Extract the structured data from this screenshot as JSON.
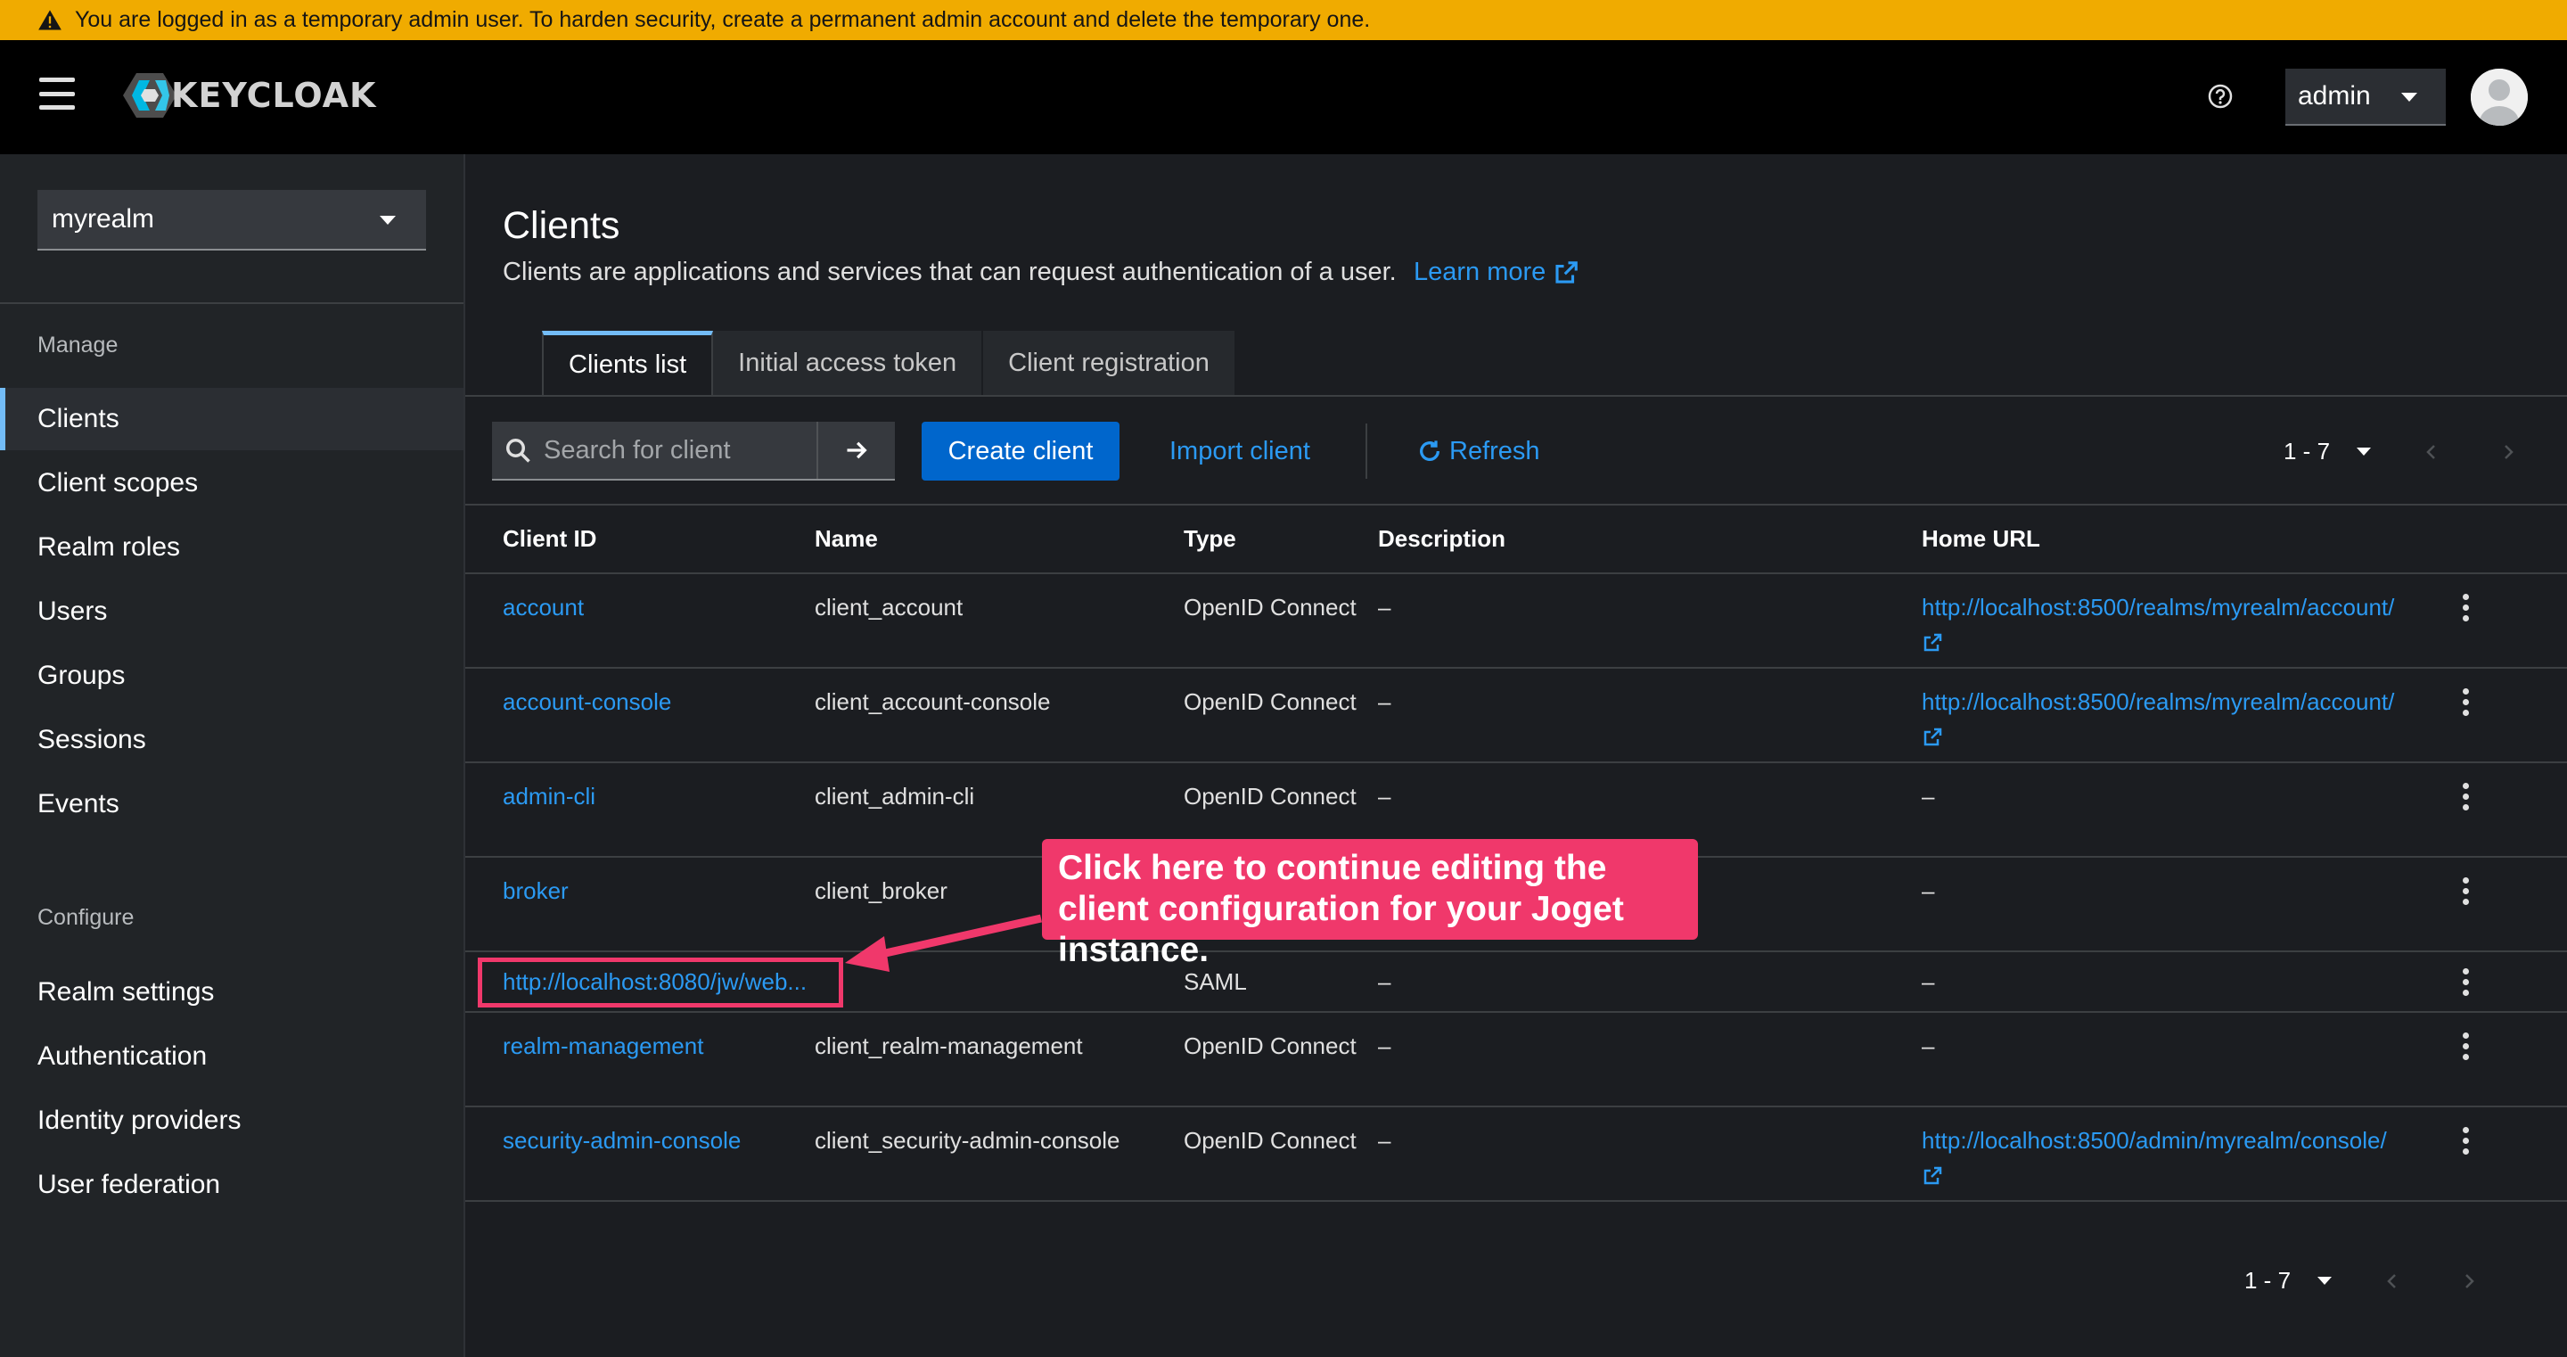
{
  "banner": {
    "text": "You are logged in as a temporary admin user. To harden security, create a permanent admin account and delete the temporary one."
  },
  "header": {
    "logo_text": "KEYCLOAK",
    "user_label": "admin"
  },
  "sidebar": {
    "realm": "myrealm",
    "manage_label": "Manage",
    "manage_items": [
      "Clients",
      "Client scopes",
      "Realm roles",
      "Users",
      "Groups",
      "Sessions",
      "Events"
    ],
    "configure_label": "Configure",
    "configure_items": [
      "Realm settings",
      "Authentication",
      "Identity providers",
      "User federation"
    ]
  },
  "page": {
    "title": "Clients",
    "description": "Clients are applications and services that can request authentication of a user.",
    "learn_more": "Learn more"
  },
  "tabs": [
    "Clients list",
    "Initial access token",
    "Client registration"
  ],
  "toolbar": {
    "search_placeholder": "Search for client",
    "create_label": "Create client",
    "import_label": "Import client",
    "refresh_label": "Refresh",
    "pagination": "1 - 7"
  },
  "table": {
    "headers": [
      "Client ID",
      "Name",
      "Type",
      "Description",
      "Home URL"
    ],
    "rows": [
      {
        "client_id": "account",
        "name": "client_account",
        "type": "OpenID Connect",
        "description": "–",
        "home_url": "http://localhost:8500/realms/myrealm/account/"
      },
      {
        "client_id": "account-console",
        "name": "client_account-console",
        "type": "OpenID Connect",
        "description": "–",
        "home_url": "http://localhost:8500/realms/myrealm/account/"
      },
      {
        "client_id": "admin-cli",
        "name": "client_admin-cli",
        "type": "OpenID Connect",
        "description": "–",
        "home_url": "–"
      },
      {
        "client_id": "broker",
        "name": "client_broker",
        "type": "",
        "description": "",
        "home_url": "–"
      },
      {
        "client_id": "http://localhost:8080/jw/web...",
        "name": "",
        "type": "SAML",
        "description": "–",
        "home_url": "–"
      },
      {
        "client_id": "realm-management",
        "name": "client_realm-management",
        "type": "OpenID Connect",
        "description": "–",
        "home_url": "–"
      },
      {
        "client_id": "security-admin-console",
        "name": "client_security-admin-console",
        "type": "OpenID Connect",
        "description": "–",
        "home_url": "http://localhost:8500/admin/myrealm/console/"
      }
    ]
  },
  "annotation": {
    "text": "Click here to continue editing the client configuration for your Joget instance."
  },
  "colors": {
    "banner": "#f0ab00",
    "link": "#2b9af3",
    "primary": "#0066cc",
    "annotation": "#f0386b",
    "active_tab": "#73bcf7"
  }
}
